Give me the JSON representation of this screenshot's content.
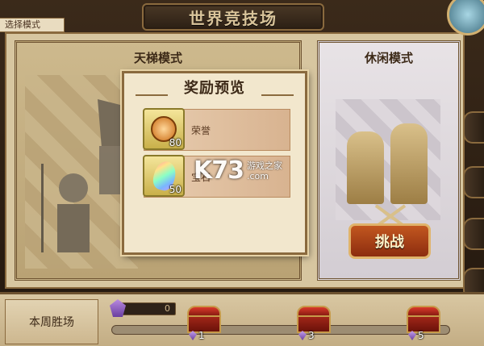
{
  "header": {
    "title": "世界竞技场",
    "mode_select_label": "选择模式"
  },
  "modes": {
    "ladder": {
      "label": "天梯模式"
    },
    "casual": {
      "label": "休闲模式",
      "challenge_label": "挑战"
    }
  },
  "reward_popup": {
    "title": "奖励预览",
    "items": [
      {
        "name": "荣誉",
        "count": "80",
        "icon": "honor-medal-icon"
      },
      {
        "name": "宝石",
        "count": "50",
        "icon": "rainbow-gem-icon"
      }
    ]
  },
  "weekly": {
    "label": "本周胜场",
    "wins": "0",
    "progress": 0,
    "chests": [
      {
        "threshold": "1"
      },
      {
        "threshold": "3"
      },
      {
        "threshold": "5"
      }
    ]
  },
  "watermark": {
    "logo": "K73",
    "line1": "游戏之家",
    "line2": ".com"
  },
  "colors": {
    "accent_gold": "#8a6a3e",
    "challenge_red": "#c2571f",
    "parchment": "#d7c6a0"
  }
}
